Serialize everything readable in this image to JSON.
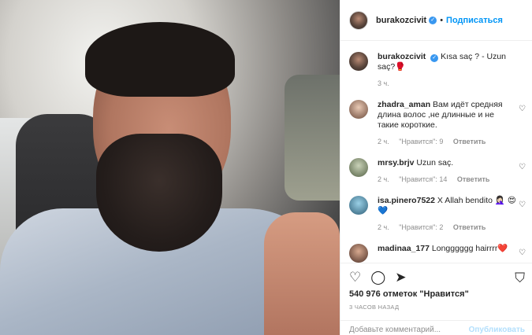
{
  "header": {
    "username": "burakozcivit",
    "separator": "•",
    "follow_label": "Подписаться"
  },
  "caption": {
    "username": "burakozcivit",
    "text": "Kısa saç ? - Uzun saç?🥊",
    "time": "3 ч."
  },
  "comments": [
    {
      "username": "zhadra_aman",
      "text": "Вам идёт средняя длина волос ,не длинные и не такие короткие.",
      "time": "2 ч.",
      "likes": "\"Нравится\": 9",
      "reply": "Ответить"
    },
    {
      "username": "mrsy.brjv",
      "text": "Uzun saç.",
      "time": "2 ч.",
      "likes": "\"Нравится\": 14",
      "reply": "Ответить"
    },
    {
      "username": "isa.pinero7522",
      "text": "X Allah bendito 🤦🏻‍♀️ 😍💙",
      "time": "2 ч.",
      "likes": "\"Нравится\": 2",
      "reply": "Ответить"
    },
    {
      "username": "madinaa_177",
      "text": "Longggggg hairrrr❤️",
      "time": "",
      "likes": "",
      "reply": ""
    }
  ],
  "actions": {
    "likes_text": "540 976 отметок \"Нравится\"",
    "timestamp": "3 ЧАСОВ НАЗАД"
  },
  "comment_box": {
    "placeholder": "Добавьте комментарий...",
    "publish_label": "Опубликовать"
  },
  "colors": {
    "link_blue": "#0095f6",
    "verified_blue": "#3897f0",
    "publish_disabled": "#b2dffc"
  },
  "icons": [
    "verified-icon",
    "heart-icon",
    "comment-icon",
    "share-icon",
    "bookmark-icon"
  ]
}
